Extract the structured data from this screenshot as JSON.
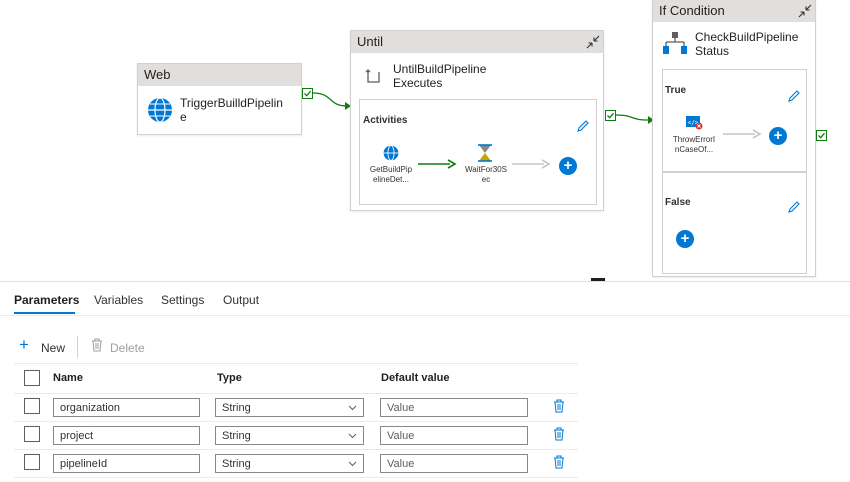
{
  "canvas": {
    "web_card": {
      "header": "Web",
      "activity": "TriggerBuilldPipeline"
    },
    "until_card": {
      "header": "Until",
      "activity": "UntilBuildPipelineExecutes",
      "activities_label": "Activities",
      "inner": [
        {
          "label": "GetBuildPipelineDet..."
        },
        {
          "label": "WaitFor30Sec"
        }
      ]
    },
    "if_card": {
      "header": "If Condition",
      "activity": "CheckBuildPipelineStatus",
      "true_label": "True",
      "false_label": "False",
      "true_activity": "ThrowErrorInCaseOf..."
    }
  },
  "tabs": [
    {
      "label": "Parameters",
      "active": true
    },
    {
      "label": "Variables",
      "active": false
    },
    {
      "label": "Settings",
      "active": false
    },
    {
      "label": "Output",
      "active": false
    }
  ],
  "toolbar": {
    "new_label": "New",
    "delete_label": "Delete"
  },
  "table": {
    "headers": {
      "name": "Name",
      "type": "Type",
      "default": "Default value"
    },
    "rows": [
      {
        "name": "organization",
        "type": "String",
        "default_placeholder": "Value"
      },
      {
        "name": "project",
        "type": "String",
        "default_placeholder": "Value"
      },
      {
        "name": "pipelineId",
        "type": "String",
        "default_placeholder": "Value"
      }
    ]
  },
  "colors": {
    "accent": "#0078d4",
    "success": "#107c10",
    "header_bg": "#e1dfdd"
  }
}
